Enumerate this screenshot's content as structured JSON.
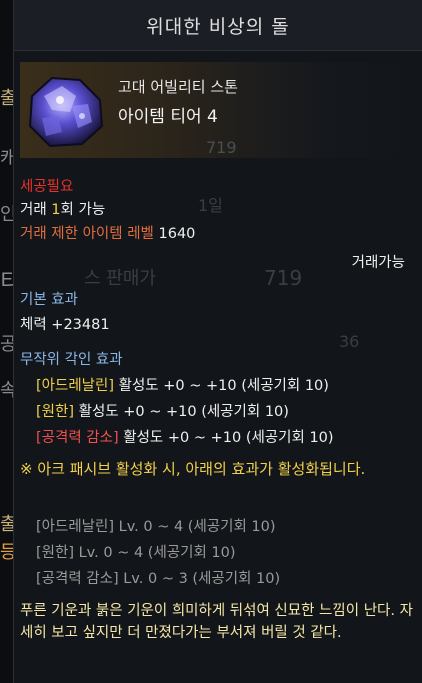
{
  "title": "위대한 비상의 돌",
  "item": {
    "grade": "고대 어빌리티 스톤",
    "tier": "아이템 티어 4",
    "ghost_value": "719"
  },
  "requirements": {
    "carve_required": "세공필요",
    "trade_prefix": "거래 ",
    "trade_count": "1",
    "trade_suffix": "회 가능",
    "trade_level_label": "거래 제한 아이템 레벨",
    "trade_level_value": "1640",
    "tradeable": "거래가능"
  },
  "basic_effect": {
    "heading": "기본 효과",
    "stat": "체력 +23481"
  },
  "random_engrave": {
    "heading": "무작위 각인 효과",
    "lines": [
      {
        "bracket": "[아드레날린]",
        "text": " 활성도 +0 ~ +10 (세공기회 10)"
      },
      {
        "bracket": "[원한]",
        "text": " 활성도 +0 ~ +10 (세공기회 10)"
      },
      {
        "bracket": "[공격력 감소]",
        "text": " 활성도 +0 ~ +10 (세공기회 10)"
      }
    ]
  },
  "ark_passive": {
    "notice": "※ 아크 패시브 활성화 시, 아래의 효과가 활성화됩니다.",
    "lines": [
      "[아드레날린] Lv. 0 ~ 4 (세공기회 10)",
      "[원한] Lv. 0 ~ 4 (세공기회 10)",
      "[공격력 감소] Lv. 0 ~ 3 (세공기회 10)"
    ]
  },
  "flavor": "푸른 기운과 붉은 기운이 희미하게 뒤섞여 신묘한 느낌이 난다. 자세히 보고 싶지만 더 만졌다가는 부서져 버릴 것 같다.",
  "background_ghost": {
    "left_chars": [
      "출",
      "캐",
      "인",
      "티",
      "공",
      "속",
      "출",
      "등"
    ],
    "price_label": "스 판매가",
    "price_value": "719",
    "qty_value": "1일",
    "num_36": "36"
  },
  "colors": {
    "red": "#e8312a",
    "orange": "#e16f3e",
    "yellow": "#f1d04a",
    "blue": "#8cb6e6",
    "gray": "#9a9a9a"
  }
}
